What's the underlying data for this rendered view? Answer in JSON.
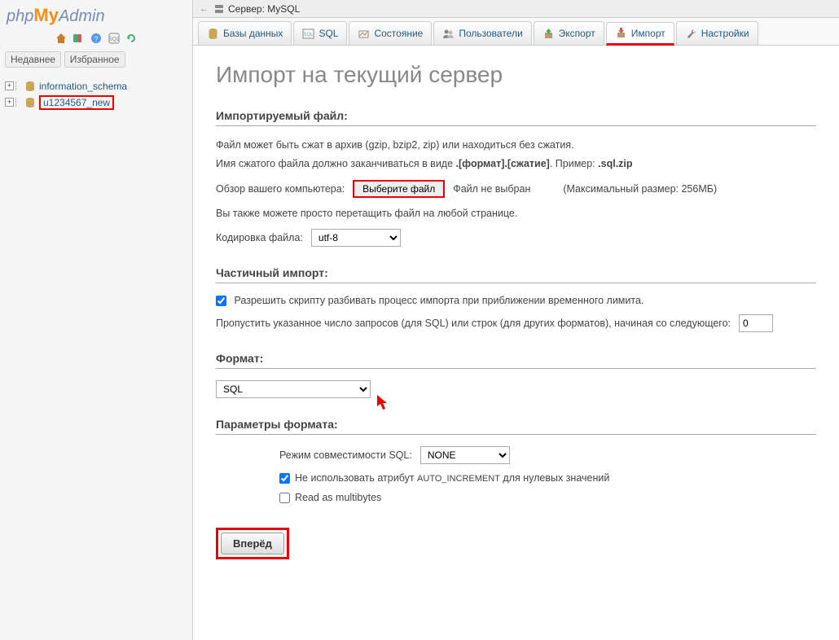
{
  "sidebar": {
    "logo": {
      "php": "php",
      "my": "My",
      "admin": "Admin"
    },
    "nav_recent": "Недавнее",
    "nav_favorites": "Избранное",
    "databases": [
      {
        "name": "information_schema",
        "highlighted": false
      },
      {
        "name": "u1234567_new",
        "highlighted": true
      }
    ]
  },
  "topbar": {
    "server_label": "Сервер: MySQL"
  },
  "tabs": [
    {
      "id": "databases",
      "label": "Базы данных"
    },
    {
      "id": "sql",
      "label": "SQL"
    },
    {
      "id": "status",
      "label": "Состояние"
    },
    {
      "id": "users",
      "label": "Пользователи"
    },
    {
      "id": "export",
      "label": "Экспорт"
    },
    {
      "id": "import",
      "label": "Импорт",
      "active": true
    },
    {
      "id": "settings",
      "label": "Настройки"
    }
  ],
  "page": {
    "title": "Импорт на текущий сервер",
    "file_section": {
      "heading": "Импортируемый файл:",
      "desc1": "Файл может быть сжат в архив (gzip, bzip2, zip) или находиться без сжатия.",
      "desc2_a": "Имя сжатого файла должно заканчиваться в виде ",
      "desc2_b": ".[формат].[сжатие]",
      "desc2_c": ". Пример: ",
      "desc2_d": ".sql.zip",
      "browse_label": "Обзор вашего компьютера:",
      "choose_file": "Выберите файл",
      "no_file": "Файл не выбран",
      "max_size": "(Максимальный размер: 256МБ)",
      "dragdrop": "Вы также можете просто перетащить файл на любой странице.",
      "charset_label": "Кодировка файла:",
      "charset_value": "utf-8"
    },
    "partial_section": {
      "heading": "Частичный импорт:",
      "allow_interrupt": "Разрешить скрипту разбивать процесс импорта при приближении временного лимита.",
      "skip_label": "Пропустить указанное число запросов (для SQL) или строк (для других форматов), начиная со следующего:",
      "skip_value": "0"
    },
    "format_section": {
      "heading": "Формат:",
      "value": "SQL"
    },
    "format_options": {
      "heading": "Параметры формата:",
      "compat_label": "Режим совместимости SQL:",
      "compat_value": "NONE",
      "no_autoinc_a": "Не использовать атрибут ",
      "no_autoinc_b": "AUTO_INCREMENT",
      "no_autoinc_c": " для нулевых значений",
      "read_multibytes": "Read as multibytes"
    },
    "submit": "Вперёд"
  }
}
